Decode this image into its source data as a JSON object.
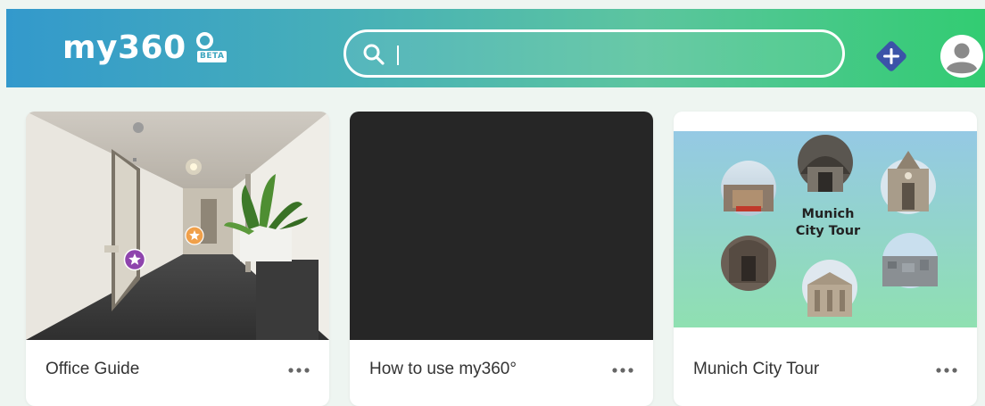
{
  "app": {
    "logo_text": "my360",
    "logo_badge": "BETA"
  },
  "search": {
    "value": "",
    "placeholder": ""
  },
  "icons": {
    "search": "search-icon",
    "add": "plus-diamond-icon",
    "account": "user-avatar-icon",
    "menu": "more-horizontal-icon"
  },
  "colors": {
    "header_start": "#3399cc",
    "header_end": "#32cc72",
    "add_button": "#3b53a8",
    "purple_hotspot": "#8e44ad",
    "orange_hotspot": "#f0a04a",
    "dark_thumbnail": "#262626"
  },
  "tours": [
    {
      "title": "Office Guide"
    },
    {
      "title": "How to use my360°"
    },
    {
      "title": "Munich City Tour",
      "thumbnail_text": [
        "Munich",
        "City Tour"
      ]
    }
  ]
}
